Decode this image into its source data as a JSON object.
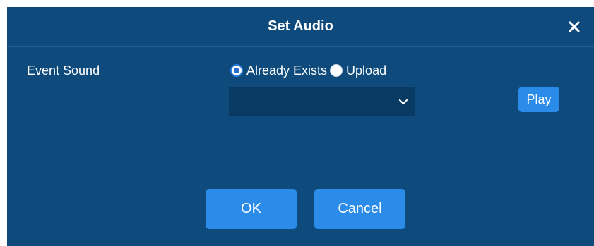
{
  "dialog": {
    "title": "Set Audio",
    "close_icon": "close-icon"
  },
  "form": {
    "event_sound_label": "Event Sound",
    "source_options": [
      {
        "label": "Already Exists",
        "checked": true
      },
      {
        "label": "Upload",
        "checked": false
      }
    ],
    "select_value": "",
    "select_icon": "chevron-down-icon",
    "play_label": "Play"
  },
  "footer": {
    "ok_label": "OK",
    "cancel_label": "Cancel"
  },
  "colors": {
    "dialog_bg": "#0f4a7c",
    "button_bg": "#2a8be8",
    "select_bg": "#093a64"
  }
}
